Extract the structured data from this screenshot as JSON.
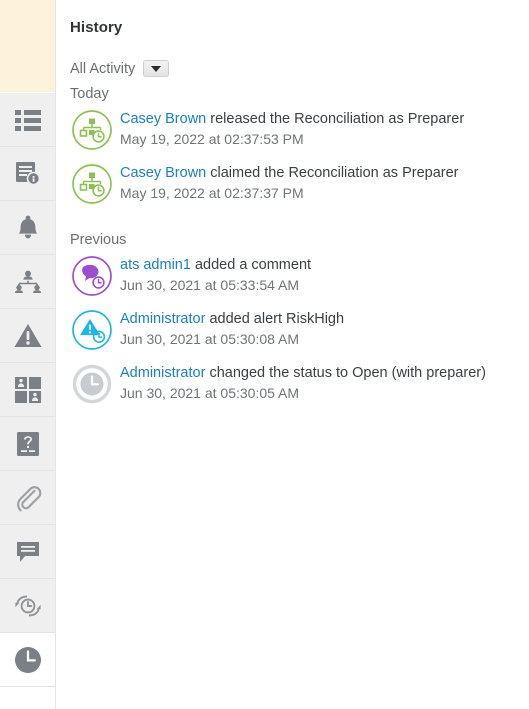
{
  "panel": {
    "title": "History",
    "filter": {
      "label": "All Activity",
      "dropdown_icon": "chevron-down-icon"
    }
  },
  "colors": {
    "link": "#1b7fc4",
    "text": "#3a3f44",
    "muted": "#6b6f73",
    "green": "#8cc152",
    "purple": "#9b4fd0",
    "cyan": "#1cb7e8",
    "gray": "#c8ccd0",
    "rail_bg": "#efefef",
    "highlight_block": "#fdf3dc"
  },
  "sidebar": {
    "items": [
      {
        "name": "sidebar-item-list",
        "icon": "list-icon",
        "active": false
      },
      {
        "name": "sidebar-item-document-info",
        "icon": "document-info-icon",
        "active": false
      },
      {
        "name": "sidebar-item-alerts",
        "icon": "bell-icon",
        "active": false
      },
      {
        "name": "sidebar-item-workflow",
        "icon": "org-chart-icon",
        "active": false
      },
      {
        "name": "sidebar-item-warnings",
        "icon": "warning-triangle-icon",
        "active": false
      },
      {
        "name": "sidebar-item-properties",
        "icon": "quadrant-people-icon",
        "active": false
      },
      {
        "name": "sidebar-item-questions",
        "icon": "question-document-icon",
        "active": false
      },
      {
        "name": "sidebar-item-attachments",
        "icon": "paperclip-icon",
        "active": false
      },
      {
        "name": "sidebar-item-comments",
        "icon": "comment-icon",
        "active": false
      },
      {
        "name": "sidebar-item-refresh-history",
        "icon": "refresh-clock-icon",
        "active": false
      },
      {
        "name": "sidebar-item-history",
        "icon": "clock-icon",
        "active": true
      }
    ]
  },
  "groups": [
    {
      "label": "Today",
      "entries": [
        {
          "icon": "workflow-clock-icon",
          "icon_color": "green",
          "actor": "Casey Brown",
          "action": " released the Reconciliation as Preparer",
          "timestamp": "May 19, 2022 at 02:37:53 PM"
        },
        {
          "icon": "workflow-clock-icon",
          "icon_color": "green",
          "actor": "Casey Brown",
          "action": " claimed the Reconciliation as Preparer",
          "timestamp": "May 19, 2022 at 02:37:37 PM"
        }
      ]
    },
    {
      "label": "Previous",
      "entries": [
        {
          "icon": "comment-clock-icon",
          "icon_color": "purple",
          "actor": "ats admin1",
          "action": " added a comment",
          "timestamp": "Jun 30, 2021 at 05:33:54 AM"
        },
        {
          "icon": "alert-clock-icon",
          "icon_color": "cyan",
          "actor": "Administrator",
          "action": " added alert RiskHigh",
          "timestamp": "Jun 30, 2021 at 05:30:08 AM"
        },
        {
          "icon": "status-clock-icon",
          "icon_color": "gray",
          "actor": "Administrator",
          "action": " changed the status to Open (with preparer)",
          "timestamp": "Jun 30, 2021 at 05:30:05 AM"
        }
      ]
    }
  ]
}
